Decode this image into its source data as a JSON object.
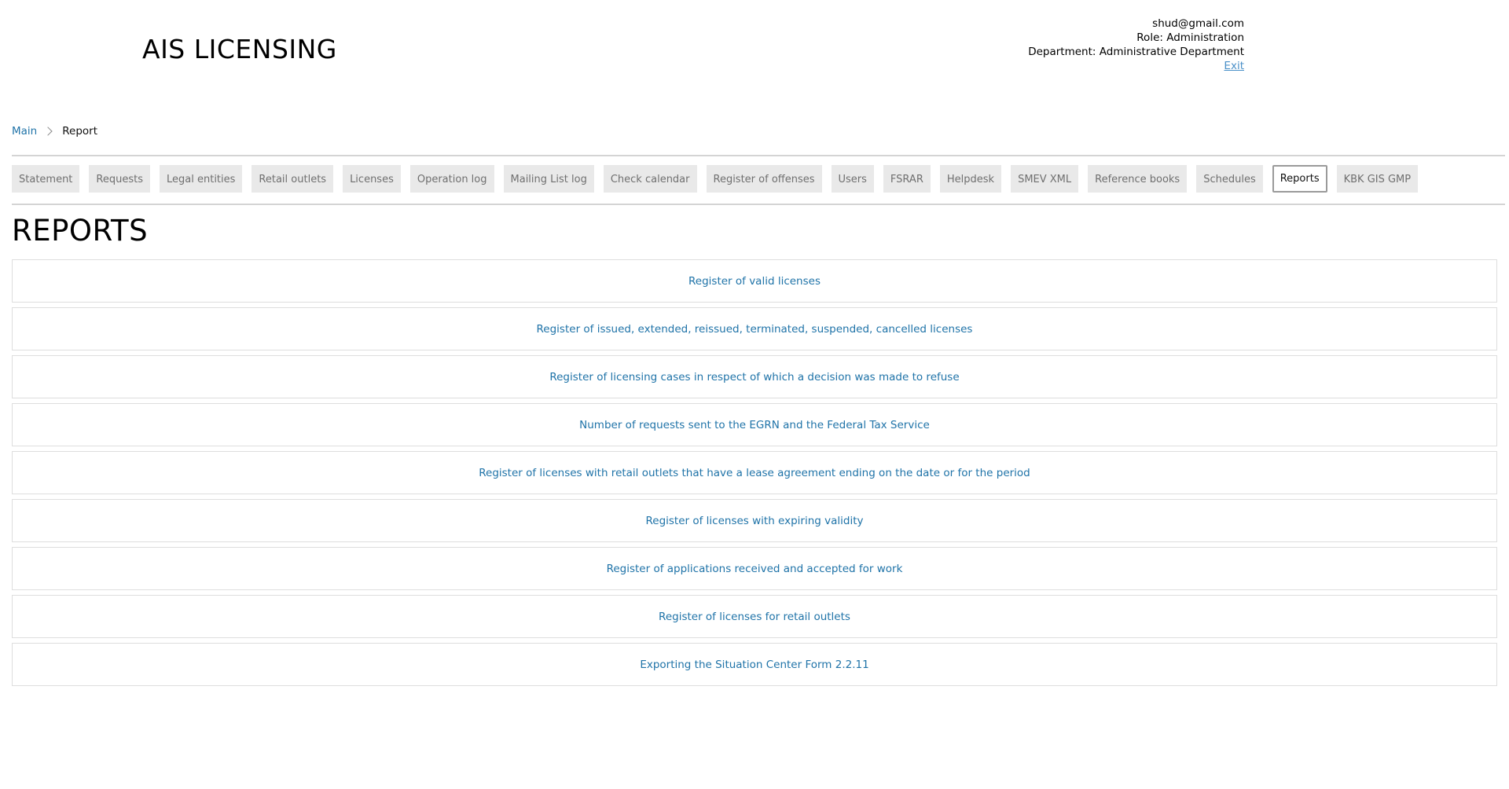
{
  "header": {
    "title": "AIS LICENSING",
    "user": {
      "email": "shud@gmail.com",
      "role": "Role: Administration",
      "department": "Department: Administrative Department",
      "exit": "Exit"
    }
  },
  "breadcrumb": {
    "main": "Main",
    "current": "Report"
  },
  "nav": {
    "items": [
      "Statement",
      "Requests",
      "Legal entities",
      "Retail outlets",
      "Licenses",
      "Operation log",
      "Mailing List log",
      "Check calendar",
      "Register of offenses",
      "Users",
      "FSRAR",
      "Helpdesk",
      "SMEV XML",
      "Reference books",
      "Schedules",
      "Reports",
      "KBK GIS GMP"
    ],
    "active": "Reports"
  },
  "page": {
    "title": "REPORTS"
  },
  "reports": [
    "Register of valid licenses",
    "Register of issued, extended, reissued, terminated, suspended, cancelled licenses",
    "Register of licensing cases in respect of which a decision was made to refuse",
    "Number of requests sent to the EGRN and the Federal Tax Service",
    "Register of licenses with retail outlets that have a lease agreement ending on the date or for the period",
    "Register of licenses with expiring validity",
    "Register of applications received and accepted for work",
    "Register of licenses for retail outlets",
    "Exporting the Situation Center Form 2.2.11"
  ],
  "colors": {
    "link": "#1f73a8",
    "nav_bg": "#e9e9e9",
    "border": "#dedede"
  }
}
